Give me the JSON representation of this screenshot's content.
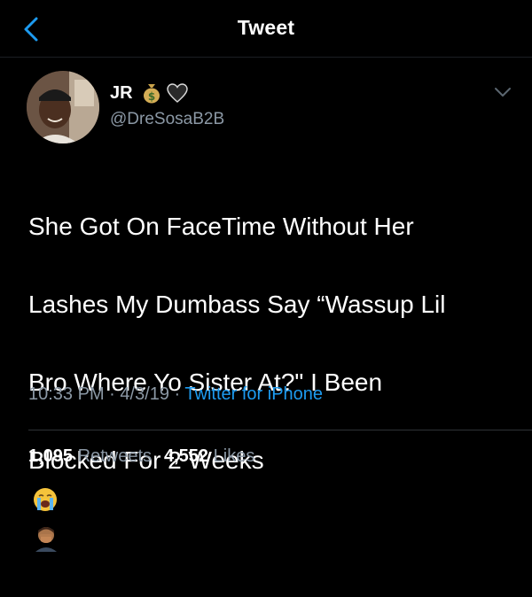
{
  "header": {
    "title": "Tweet",
    "back_icon": "chevron-left-icon"
  },
  "user": {
    "display_name": "JR",
    "badges": [
      "money-bag-icon",
      "black-heart-icon"
    ],
    "handle": "@DreSosaB2B"
  },
  "tweet": {
    "line1": "She Got On FaceTime Without Her",
    "line2": "Lashes My Dumbass Say “Wassup Lil",
    "line3": "Bro Where Yo Sister At?\" I Been",
    "line4": "Blocked For 2 Weeks",
    "emojis": [
      "loudly-crying-face-icon",
      "man-facepalming-icon"
    ]
  },
  "meta": {
    "time": "10:33 PM",
    "sep1": " · ",
    "date": "4/3/19",
    "sep2": " · ",
    "source": "Twitter for iPhone"
  },
  "stats": {
    "retweets_count": "1,095",
    "retweets_label": "Retweets",
    "likes_count": "4,552",
    "likes_label": "Likes"
  },
  "colors": {
    "background": "#000000",
    "text": "#ffffff",
    "secondary": "#8b98a5",
    "accent": "#1d9bf0"
  }
}
